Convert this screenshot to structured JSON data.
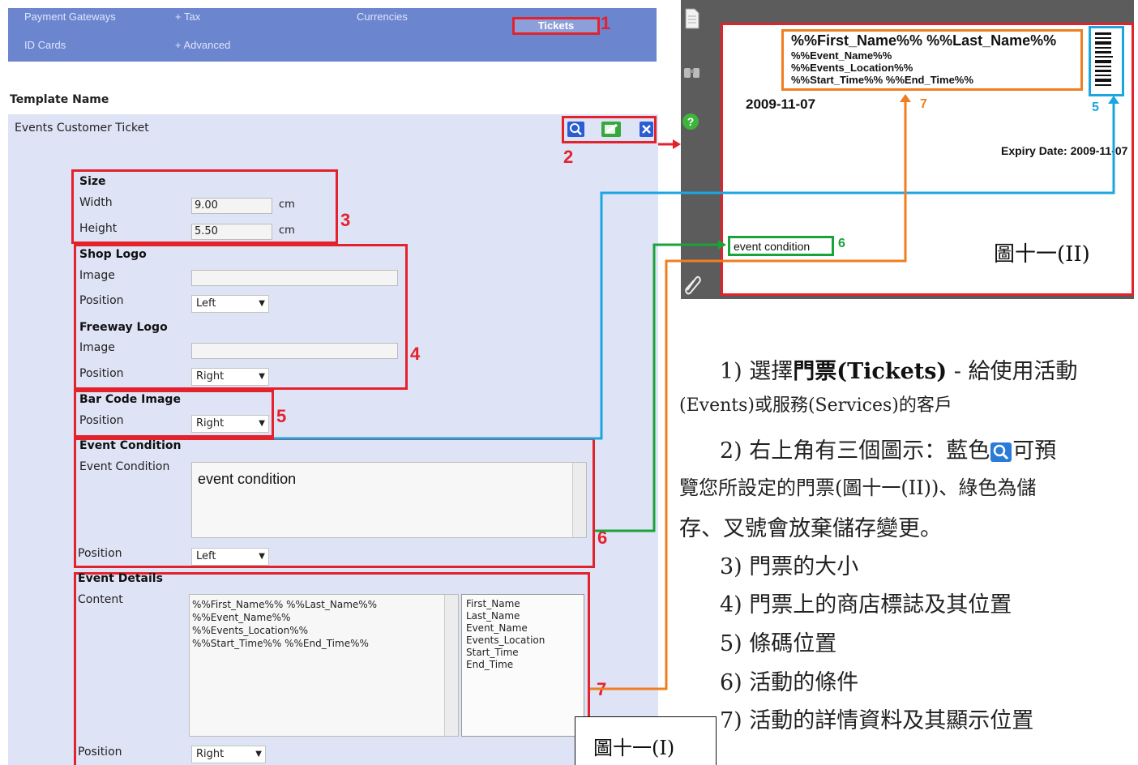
{
  "nav": {
    "payment_gateways": "Payment Gateways",
    "tax": "+ Tax",
    "currencies": "Currencies",
    "tickets": "Tickets",
    "id_cards": "ID Cards",
    "advanced": "+ Advanced"
  },
  "form": {
    "template_name_label": "Template Name",
    "template_name_value": "Events Customer Ticket",
    "size": {
      "heading": "Size",
      "width_label": "Width",
      "width_value": "9.00",
      "height_label": "Height",
      "height_value": "5.50",
      "unit": "cm"
    },
    "shop_logo": {
      "heading": "Shop Logo",
      "image_label": "Image",
      "position_label": "Position",
      "position_value": "Left"
    },
    "freeway_logo": {
      "heading": "Freeway Logo",
      "image_label": "Image",
      "position_label": "Position",
      "position_value": "Right"
    },
    "barcode": {
      "heading": "Bar Code Image",
      "position_label": "Position",
      "position_value": "Right"
    },
    "event_condition": {
      "heading": "Event Condition",
      "label": "Event Condition",
      "value": "event condition",
      "position_label": "Position",
      "position_value": "Left"
    },
    "event_details": {
      "heading": "Event Details",
      "content_label": "Content",
      "content_lines": [
        "%%First_Name%% %%Last_Name%%",
        "%%Event_Name%%",
        "%%Events_Location%%",
        "%%Start_Time%% %%End_Time%%"
      ],
      "fields": [
        "First_Name",
        "Last_Name",
        "Event_Name",
        "Events_Location",
        "Start_Time",
        "End_Time"
      ],
      "position_label": "Position",
      "position_value": "Right"
    }
  },
  "markers": {
    "m1": "1",
    "m2": "2",
    "m3": "3",
    "m4": "4",
    "m5": "5",
    "m6": "6",
    "m7": "7"
  },
  "fig_label_1": "圖十一(I)",
  "preview": {
    "line1": "%%First_Name%% %%Last_Name%%",
    "line2": "%%Event_Name%%",
    "line3": "%%Events_Location%%",
    "line4": "%%Start_Time%% %%End_Time%%",
    "date": "2009-11-07",
    "expiry": "Expiry Date: 2009-11-07",
    "condition": "event condition",
    "fig_label": "圖十一(II)",
    "help_glyph": "?"
  },
  "instructions": {
    "p1a": "1)  選擇",
    "p1b": "門票(Tickets)",
    "p1c": " -  給使用活動",
    "p1d": "(Events)或服務(Services)的客戶",
    "p2a": "2)  右上角有三個圖示：藍色",
    "p2b": "可預",
    "p2c": "覽您所設定的門票(圖十一(II))、綠色為儲",
    "p2d": "存、叉號會放棄儲存變更。",
    "p3": "3)  門票的大小",
    "p4": "4)  門票上的商店標誌及其位置",
    "p5": "5)  條碼位置",
    "p6": "6)  活動的條件",
    "p7": "7)  活動的詳情資料及其顯示位置"
  },
  "colors": {
    "red": "#e3222c",
    "blue": "#1ca6e0",
    "green": "#1aa33a",
    "orange": "#f07e1e",
    "nav": "#6b85cf",
    "form": "#dfe3f6"
  }
}
